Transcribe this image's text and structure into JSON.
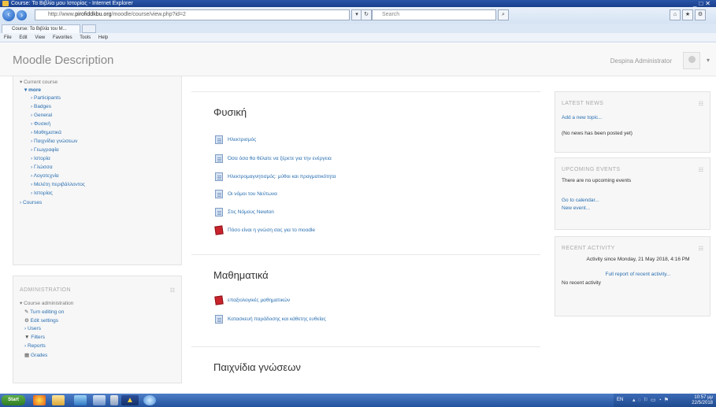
{
  "browser": {
    "title": "Course: Τα Βιβλία μου Ιστορίας - Internet Explorer",
    "address_prefix": "http://www.",
    "address_host": "pirofiddkbu.org",
    "address_rest": "/moodle/course/view.php?id=2",
    "search_placeholder": "Search",
    "tab_label": "Course: Τα Βιβλία του Μ...",
    "menu": [
      "File",
      "Edit",
      "View",
      "Favorites",
      "Tools",
      "Help"
    ]
  },
  "header": {
    "brand": "Moodle Description",
    "user": "Despina Administrator"
  },
  "nav": {
    "current_course": "Current course",
    "course_short": "more",
    "items": [
      "Participants",
      "Badges",
      "General",
      "Φυσική",
      "Μαθηματικά",
      "Παιχνίδια γνώσεων",
      "Γεωγραφία",
      "Ιστορία",
      "Γλώσσα",
      "Λογοτεχνία",
      "Μελέτη περιβάλλοντος",
      "Ιστορίας"
    ],
    "courses": "Courses"
  },
  "admin": {
    "title": "ADMINISTRATION",
    "course_admin": "Course administration",
    "items": [
      "Turn editing on",
      "Edit settings",
      "Users",
      "Filters",
      "Reports",
      "Grades"
    ]
  },
  "sections": [
    {
      "title": "Φυσική",
      "activities": [
        {
          "type": "page",
          "label": "Ηλεκτρισμός"
        },
        {
          "type": "page",
          "label": "Όσα όσα θα θέλατε να ξέρετε για την ενέργεια"
        },
        {
          "type": "page",
          "label": "Ηλεκτρομαγνητισμός: μύθοι και πραγματικότητα"
        },
        {
          "type": "page",
          "label": "Οι νόμοι του Νεύτωνα"
        },
        {
          "type": "page",
          "label": "Στις Νόμους Newton"
        },
        {
          "type": "quiz",
          "label": "Πόσο είναι η γνώση σας για το moodle"
        }
      ]
    },
    {
      "title": "Μαθηματικά",
      "activities": [
        {
          "type": "quiz",
          "label": "επαξιολογικές μαθηματικών"
        },
        {
          "type": "page",
          "label": "Κατασκευή παράδοσης και κάθετης ευθείας"
        }
      ]
    },
    {
      "title": "Παιχνίδια γνώσεων",
      "activities": []
    }
  ],
  "blocks": {
    "latest_news": {
      "title": "LATEST NEWS",
      "add": "Add a new topic...",
      "empty": "(No news has been posted yet)"
    },
    "upcoming": {
      "title": "UPCOMING EVENTS",
      "empty": "There are no upcoming events",
      "calendar": "Go to calendar...",
      "new_event": "New event..."
    },
    "recent": {
      "title": "RECENT ACTIVITY",
      "since": "Activity since Monday, 21 May 2018, 4:16 PM",
      "full": "Full report of recent activity...",
      "none": "No recent activity"
    }
  },
  "taskbar": {
    "start": "Start",
    "lang": "EN",
    "time": "10:57 μμ",
    "date": "22/5/2018"
  }
}
